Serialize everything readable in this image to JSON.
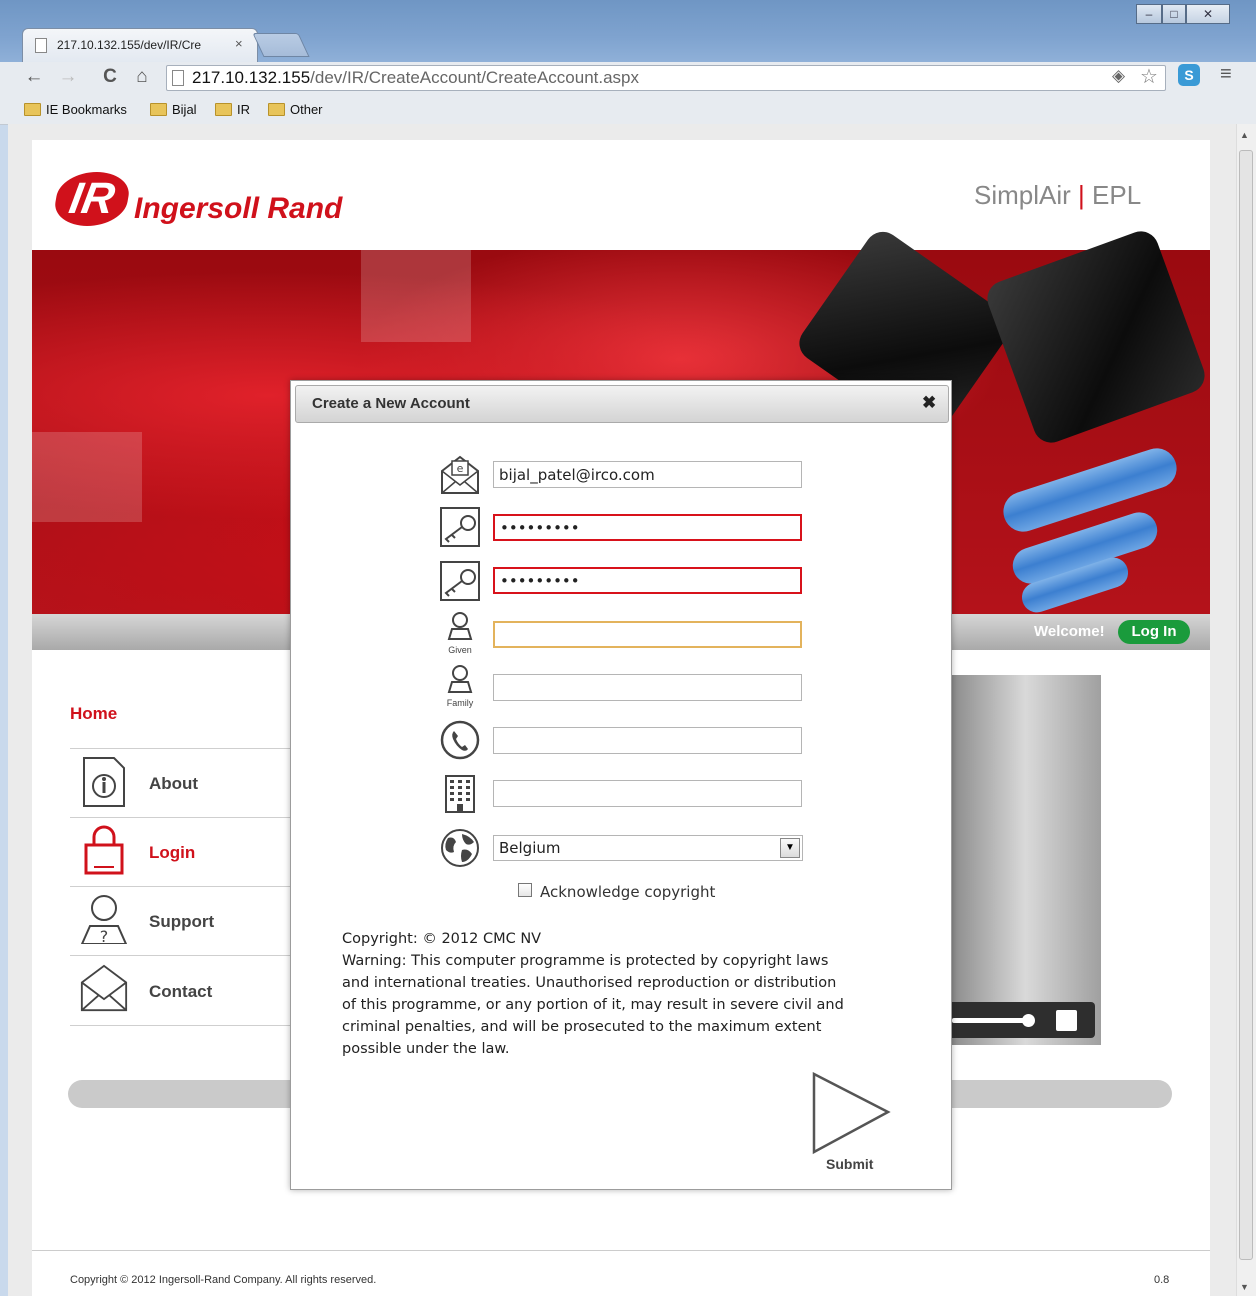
{
  "browser": {
    "tab_title": "217.10.132.155/dev/IR/Cre",
    "tab_close": "×",
    "url_host": "217.10.132.155",
    "url_path": "/dev/IR/CreateAccount/CreateAccount.aspx",
    "bookmarks": [
      "IE Bookmarks",
      "Bijal",
      "IR",
      "Other"
    ]
  },
  "header": {
    "logo_mark": "IR",
    "logo_text": "Ingersoll Rand",
    "app_name_left": "SimplAir",
    "app_name_sep": "|",
    "app_name_right": "EPL",
    "welcome": "Welcome!",
    "login_button": "Log In"
  },
  "nav": {
    "home": "Home",
    "items": [
      {
        "label": "About",
        "icon": "info-document-icon"
      },
      {
        "label": "Login",
        "icon": "padlock-icon"
      },
      {
        "label": "Support",
        "icon": "support-person-icon"
      },
      {
        "label": "Contact",
        "icon": "envelope-icon"
      }
    ]
  },
  "modal": {
    "title": "Create a New Account",
    "close": "✖",
    "email_value": "bijal_patel@irco.com",
    "password_value": "•••••••••",
    "confirm_password_value": "•••••••••",
    "given_value": "",
    "given_label": "Given",
    "family_value": "",
    "family_label": "Family",
    "phone_value": "",
    "company_value": "",
    "country_value": "Belgium",
    "acknowledge_label": "Acknowledge copyright",
    "copyright_lines": [
      "Copyright: © 2012 CMC NV",
      "Warning: This computer programme is protected by copyright laws",
      "and international treaties. Unauthorised reproduction or distribution",
      "of this programme, or any portion of it, may result in severe civil and",
      "criminal penalties, and will be prosecuted to the maximum extent",
      "possible under the law."
    ],
    "submit_label": "Submit"
  },
  "footer": {
    "copyright": "Copyright © 2012 Ingersoll-Rand Company. All rights reserved.",
    "version": "0.8"
  },
  "colors": {
    "brand_red": "#d0111b",
    "login_green": "#1a9b3c",
    "error_border": "#d8121b",
    "focus_border": "#e3b35c"
  }
}
